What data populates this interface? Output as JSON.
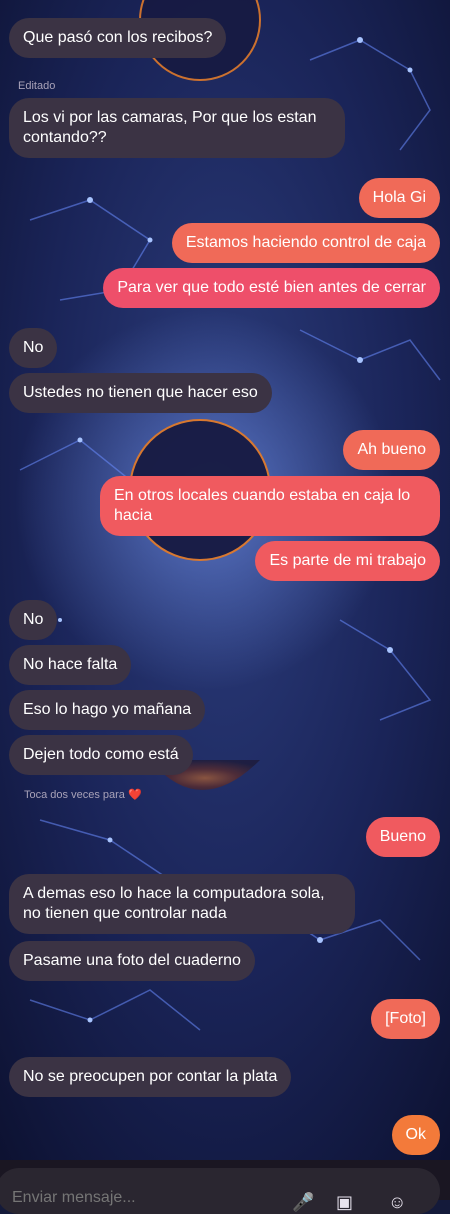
{
  "messages": [
    {
      "side": "in",
      "text": "Que pasó con los recibos?"
    },
    {
      "side": "in",
      "text": "Los vi por las camaras, Por que los estan contando??",
      "label": "Editado"
    },
    {
      "side": "out",
      "text": "Hola Gi"
    },
    {
      "side": "out",
      "text": "Estamos haciendo control de caja"
    },
    {
      "side": "out",
      "text": "Para ver que todo esté bien antes de cerrar"
    },
    {
      "side": "in",
      "text": "No"
    },
    {
      "side": "in",
      "text": "Ustedes no tienen que hacer eso"
    },
    {
      "side": "out",
      "text": "Ah bueno"
    },
    {
      "side": "out",
      "text": "En otros locales cuando estaba en caja lo hacia"
    },
    {
      "side": "out",
      "text": "Es parte de mi trabajo"
    },
    {
      "side": "in",
      "text": "No"
    },
    {
      "side": "in",
      "text": "No hace falta"
    },
    {
      "side": "in",
      "text": "Eso lo hago yo mañana"
    },
    {
      "side": "in",
      "text": "Dejen todo como está"
    },
    {
      "side": "out",
      "text": "Bueno"
    },
    {
      "side": "in",
      "text": "A demas eso lo hace la computadora sola, no tienen que controlar nada"
    },
    {
      "side": "in",
      "text": "Pasame una foto del cuaderno"
    },
    {
      "side": "out",
      "text": "[Foto]"
    },
    {
      "side": "in",
      "text": "No se preocupen por contar la plata"
    },
    {
      "side": "out",
      "text": "Ok"
    }
  ],
  "hint": {
    "text": "Toca dos veces para",
    "emoji": "❤️"
  },
  "composer": {
    "placeholder": "Enviar mensaje...",
    "icons": [
      "microphone-icon",
      "image-icon",
      "sticker-icon"
    ]
  },
  "colors": {
    "incoming": "#3b3344",
    "outgoing_top": "#f06a58",
    "outgoing_bottom": "#ee4f6a",
    "background": "#141a3a"
  }
}
